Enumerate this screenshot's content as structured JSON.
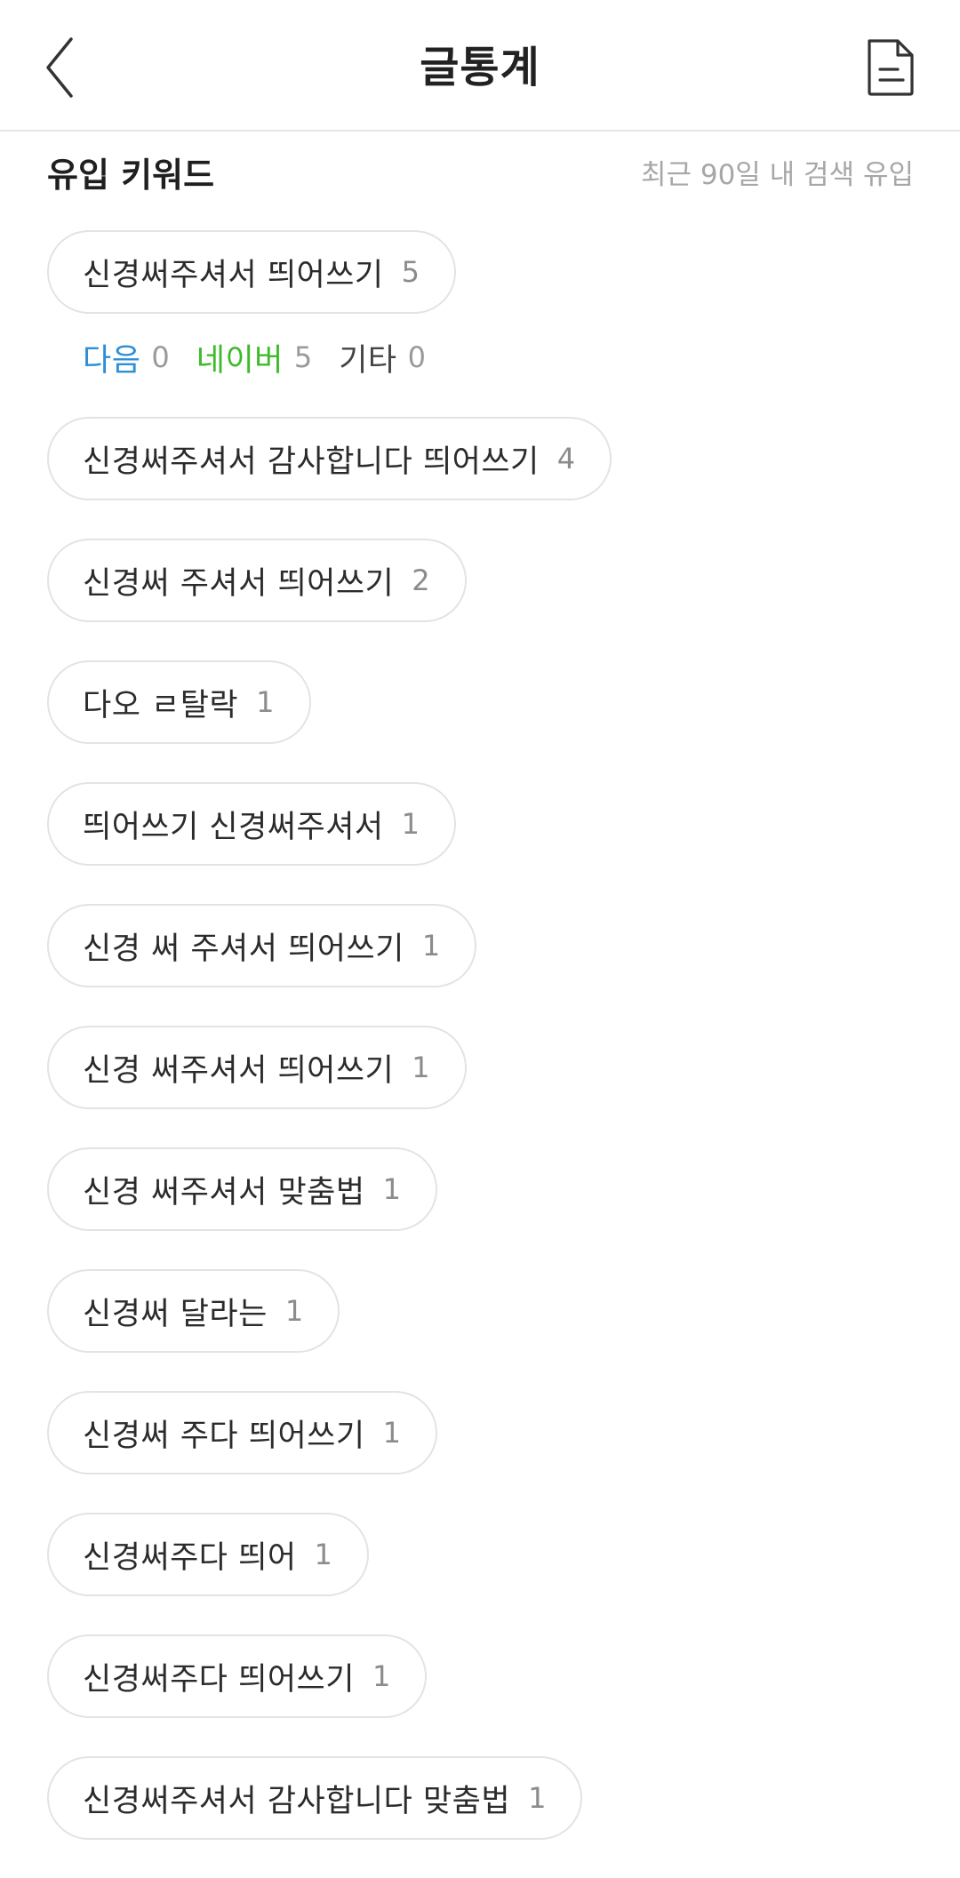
{
  "header": {
    "title": "글통계",
    "back_icon": "chevron-left-icon",
    "doc_icon": "document-icon"
  },
  "section": {
    "title": "유입 키워드",
    "subtitle": "최근 90일 내 검색 유입"
  },
  "sources": [
    {
      "name": "다음",
      "count": "0",
      "color": "#2c8fd6"
    },
    {
      "name": "네이버",
      "count": "5",
      "color": "#3dbb2b"
    },
    {
      "name": "기타",
      "count": "0",
      "color": "#444444"
    }
  ],
  "keywords": [
    {
      "text": "신경써주셔서 띄어쓰기",
      "count": "5"
    },
    {
      "text": "신경써주셔서 감사합니다 띄어쓰기",
      "count": "4"
    },
    {
      "text": "신경써 주셔서 띄어쓰기",
      "count": "2"
    },
    {
      "text": "다오 ㄹ탈락",
      "count": "1"
    },
    {
      "text": "띄어쓰기 신경써주셔서",
      "count": "1"
    },
    {
      "text": "신경 써 주셔서 띄어쓰기",
      "count": "1"
    },
    {
      "text": "신경 써주셔서 띄어쓰기",
      "count": "1"
    },
    {
      "text": "신경 써주셔서 맞춤법",
      "count": "1"
    },
    {
      "text": "신경써 달라는",
      "count": "1"
    },
    {
      "text": "신경써 주다 띄어쓰기",
      "count": "1"
    },
    {
      "text": "신경써주다 띄어",
      "count": "1"
    },
    {
      "text": "신경써주다 띄어쓰기",
      "count": "1"
    },
    {
      "text": "신경써주셔서 감사합니다 맞춤법",
      "count": "1"
    }
  ]
}
